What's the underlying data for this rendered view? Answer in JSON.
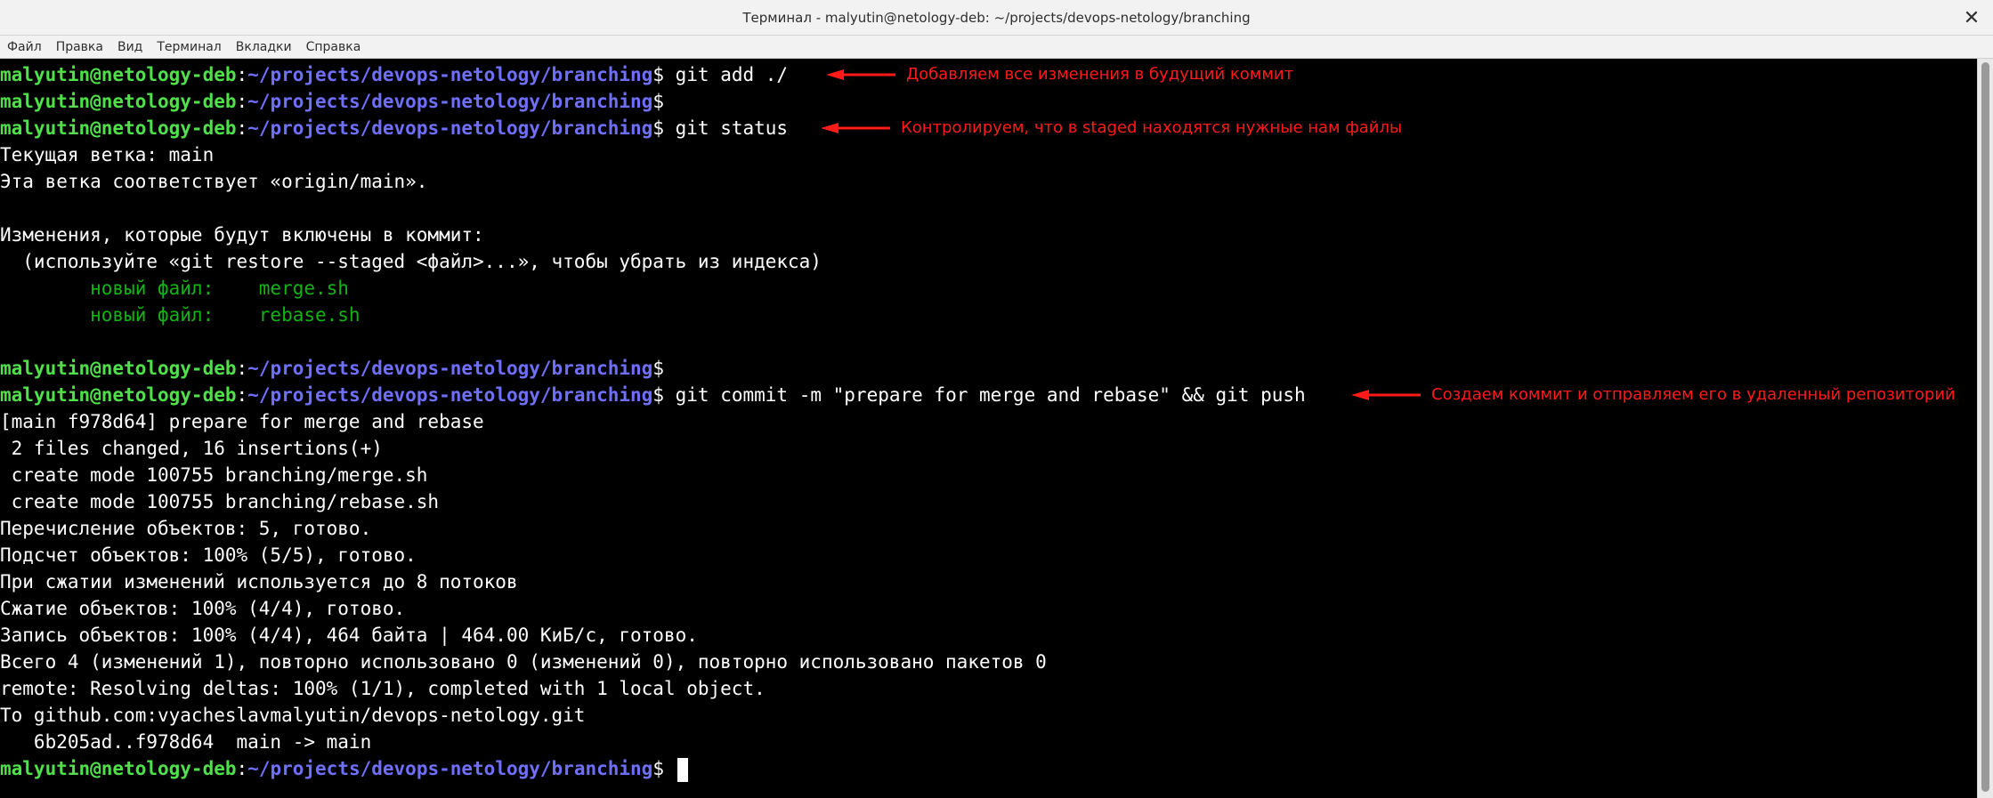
{
  "window": {
    "title": "Терминал - malyutin@netology-deb: ~/projects/devops-netology/branching"
  },
  "menu": [
    "Файл",
    "Правка",
    "Вид",
    "Терминал",
    "Вкладки",
    "Справка"
  ],
  "prompt": {
    "user": "malyutin@netology-deb",
    "path": "~/projects/devops-netology/branching",
    "sign": "$"
  },
  "lines": {
    "l0": "git add ./",
    "l2": "git status",
    "l3": "Текущая ветка: main",
    "l4": "Эта ветка соответствует «origin/main».",
    "l6": "Изменения, которые будут включены в коммит:",
    "l7": "  (используйте «git restore --staged <файл>...», чтобы убрать из индекса)",
    "l8": "        новый файл:    merge.sh",
    "l9": "        новый файл:    rebase.sh",
    "l12": "git commit -m \"prepare for merge and rebase\" && git push",
    "l13": "[main f978d64] prepare for merge and rebase",
    "l14": " 2 files changed, 16 insertions(+)",
    "l15": " create mode 100755 branching/merge.sh",
    "l16": " create mode 100755 branching/rebase.sh",
    "l17": "Перечисление объектов: 5, готово.",
    "l18": "Подсчет объектов: 100% (5/5), готово.",
    "l19": "При сжатии изменений используется до 8 потоков",
    "l20": "Сжатие объектов: 100% (4/4), готово.",
    "l21": "Запись объектов: 100% (4/4), 464 байта | 464.00 КиБ/с, готово.",
    "l22": "Всего 4 (изменений 1), повторно использовано 0 (изменений 0), повторно использовано пакетов 0",
    "l23": "remote: Resolving deltas: 100% (1/1), completed with 1 local object.",
    "l24": "To github.com:vyacheslavmalyutin/devops-netology.git",
    "l25": "   6b205ad..f978d64  main -> main"
  },
  "annotations": {
    "a0": "Добавляем все изменения в будущий коммит",
    "a2": "Контролируем, что в staged находятся нужные нам файлы",
    "a12": "Создаем коммит и отправляем его в удаленный репозиторий"
  },
  "colors": {
    "background": "#000000",
    "prompt_user": "#4fe04a",
    "prompt_path": "#6f6ffc",
    "staged_files": "#12b312",
    "annotation": "#ff1a1a"
  }
}
